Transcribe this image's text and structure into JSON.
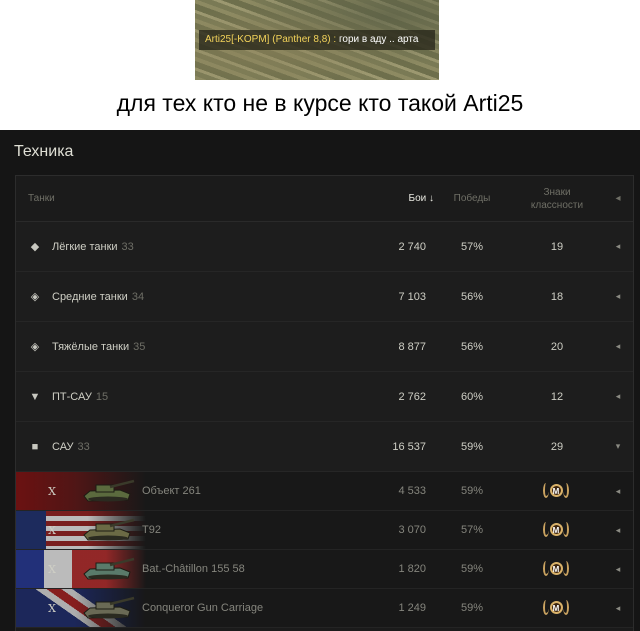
{
  "chat": {
    "player": "Arti25[-KOPM] (Panther 8,8) :",
    "message": " гори в аду .. арта"
  },
  "caption": "для тех кто не в курсе кто такой Arti25",
  "panel": {
    "title": "Техника",
    "columns": {
      "tanks": "Танки",
      "battles": "Бои ↓",
      "wins": "Победы",
      "class_marks": "Знаки классности"
    },
    "categories": [
      {
        "label": "Лёгкие танки",
        "count": "33",
        "battles": "2 740",
        "wins": "57%",
        "marks": "19",
        "icon": "light-tank-icon",
        "glyph": "◆"
      },
      {
        "label": "Средние танки",
        "count": "34",
        "battles": "7 103",
        "wins": "56%",
        "marks": "18",
        "icon": "medium-tank-icon",
        "glyph": "◈"
      },
      {
        "label": "Тяжёлые танки",
        "count": "35",
        "battles": "8 877",
        "wins": "56%",
        "marks": "20",
        "icon": "heavy-tank-icon",
        "glyph": "◈"
      },
      {
        "label": "ПТ-САУ",
        "count": "15",
        "battles": "2 762",
        "wins": "60%",
        "marks": "12",
        "icon": "td-icon",
        "glyph": "▼"
      },
      {
        "label": "САУ",
        "count": "33",
        "battles": "16 537",
        "wins": "59%",
        "marks": "29",
        "icon": "spg-icon",
        "glyph": "■"
      }
    ],
    "vehicles": [
      {
        "tier": "X",
        "name": "Объект 261",
        "battles": "4 533",
        "wins": "59%",
        "mastery": "M",
        "nation": "ussr",
        "tank_color": "#5b6a3e"
      },
      {
        "tier": "X",
        "name": "T92",
        "battles": "3 070",
        "wins": "57%",
        "mastery": "M",
        "nation": "usa",
        "tank_color": "#6b6a45"
      },
      {
        "tier": "X",
        "name": "Bat.-Châtillon 155 58",
        "battles": "1 820",
        "wins": "59%",
        "mastery": "M",
        "nation": "france",
        "tank_color": "#5a7a6a"
      },
      {
        "tier": "X",
        "name": "Conqueror Gun Carriage",
        "battles": "1 249",
        "wins": "59%",
        "mastery": "M",
        "nation": "uk",
        "tank_color": "#6a6a55"
      }
    ]
  }
}
